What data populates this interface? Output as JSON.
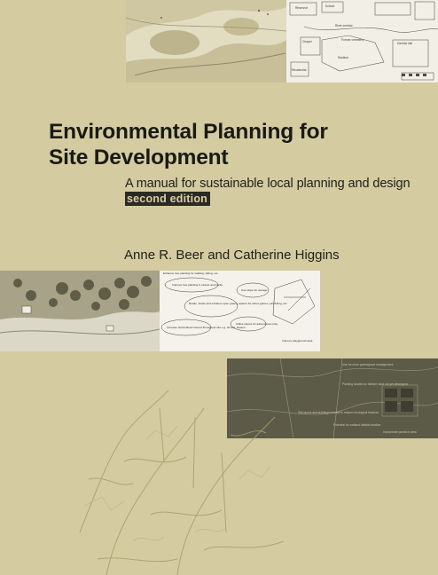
{
  "book": {
    "title_line1": "Environmental Planning for",
    "title_line2": "Site Development",
    "subtitle": "A manual for sustainable local planning and design",
    "edition": "second edition",
    "authors": "Anne R. Beer and Catherine Higgins"
  },
  "top_right_map": {
    "labels": [
      "Reservoir",
      "School",
      "River corridor",
      "Former cemetery",
      "Derelict site",
      "Chapel",
      "Stadium",
      "Residential"
    ]
  },
  "middle_right_diagram": {
    "notes": [
      "Enhance tree planting for walking, sitting, etc.",
      "Improve tree planting in streets and parks",
      "Retain, divide and enhance open grassy spaces for active games, picnicking, etc.",
      "Increase horticultural interest throughout site e.g. shrubs, flowers",
      "Utilise slopes for adventurous play",
      "Use slope for storage",
      "Improve playground area"
    ]
  },
  "lower_right_map": {
    "notes": [
      "Use for more greenspace management",
      "Planting located on steeper land not yet developed",
      "Site layout and buildings located to respect ecological features",
      "Potential for wetland habitat creation",
      "Incorporate ponds in area"
    ]
  },
  "colors": {
    "background": "#d4cba1",
    "title_text": "#1a1a14",
    "edition_band": "#2b2b24",
    "dark_map": "#5a5945",
    "sketch": "#a79d6f"
  }
}
